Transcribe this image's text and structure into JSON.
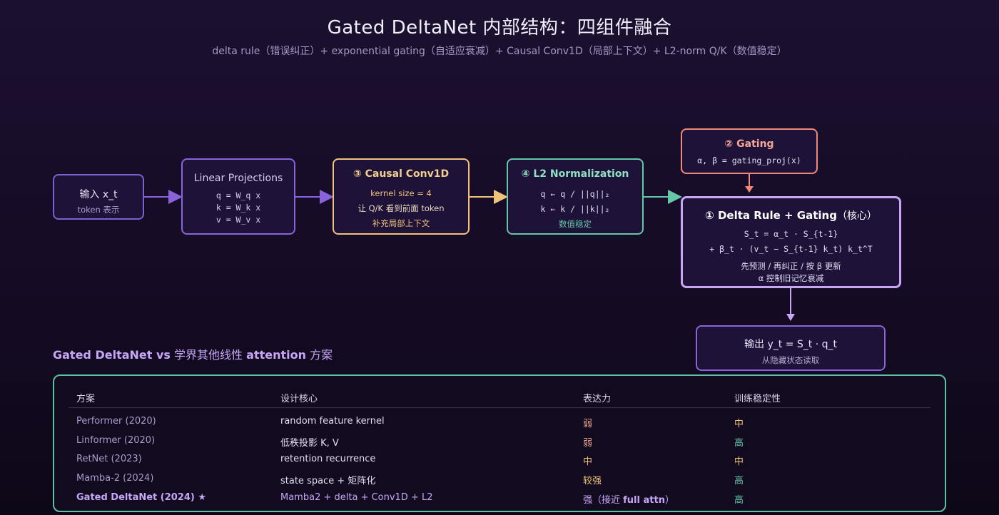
{
  "title": "Gated DeltaNet 内部结构：四组件融合",
  "subtitle": "delta rule（错误纠正）+ exponential gating（自适应衰减）+ Causal Conv1D（局部上下文）+ L2-norm Q/K（数值稳定）",
  "nodes": {
    "input": {
      "title": "输入 x_t",
      "sub": "token 表示"
    },
    "proj": {
      "title": "Linear Projections",
      "lines": [
        "q = W_q x",
        "k = W_k x",
        "v = W_v x"
      ]
    },
    "conv": {
      "title": "③ Causal Conv1D",
      "lines": [
        "kernel size = 4",
        "让 Q/K 看到前面 token",
        "补充局部上下文"
      ]
    },
    "l2": {
      "title": "④ L2 Normalization",
      "lines": [
        "q ← q / ||q||₂",
        "k ← k / ||k||₂"
      ],
      "note": "数值稳定"
    },
    "gating": {
      "title": "② Gating",
      "formula": "α, β = gating_proj(x)"
    },
    "delta": {
      "title": "① Delta Rule + Gating",
      "title_suffix": "（核心）",
      "formula1": "S_t = α_t · S_{t-1}",
      "formula2": "+ β_t · (v_t − S_{t-1} k_t) k_t^T",
      "note1": "先预测 / 再纠正 / 按 β 更新",
      "note2": "α 控制旧记忆衰减"
    },
    "output": {
      "title": "输出 y_t = S_t · q_t",
      "sub": "从隐藏状态读取"
    }
  },
  "comparison": {
    "title_bold1": "Gated DeltaNet vs",
    "title_mid": " 学界其他线性 ",
    "title_bold2": "attention",
    "title_end": " 方案",
    "headers": [
      "方案",
      "设计核心",
      "表达力",
      "训练稳定性"
    ],
    "rows": [
      {
        "scheme": "Performer (2020)",
        "core": "random feature kernel",
        "expr": "弱",
        "stab": "中"
      },
      {
        "scheme": "Linformer (2020)",
        "core": "低秩投影 K, V",
        "expr": "弱",
        "stab": "高"
      },
      {
        "scheme": "RetNet (2023)",
        "core": "retention recurrence",
        "expr": "中",
        "stab": "中"
      },
      {
        "scheme": "Mamba-2 (2024)",
        "core": "state space + 矩阵化",
        "expr": "较强",
        "stab": "高"
      },
      {
        "scheme": "Gated DeltaNet (2024) ★",
        "core": "Mamba2 + delta + Conv1D + L2",
        "expr_pre": "强（接近 ",
        "expr_bold": "full attn",
        "expr_post": "）",
        "stab": "高"
      }
    ]
  },
  "colors": {
    "weak": "#f0a58e",
    "mid": "#f0c27a",
    "high": "#66c7a7",
    "accent": "#c7a6f7"
  }
}
